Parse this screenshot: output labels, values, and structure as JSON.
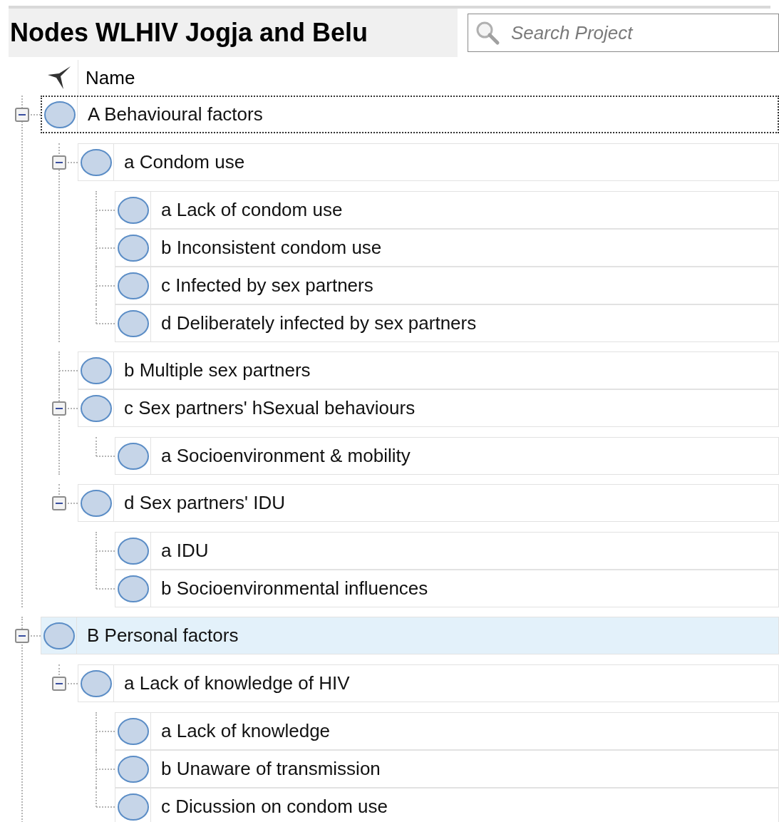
{
  "title": "Nodes WLHIV Jogja and Belu",
  "search": {
    "placeholder": "Search Project"
  },
  "columns": [
    "Name"
  ],
  "nodes": [
    {
      "name": "A Behavioural factors",
      "expanded": true,
      "selected": false,
      "focused": true,
      "children": [
        {
          "name": "a Condom use",
          "expanded": true,
          "selected": false,
          "focused": false,
          "children": [
            {
              "name": "a Lack of condom use",
              "selected": false,
              "focused": false
            },
            {
              "name": "b Inconsistent condom use",
              "selected": false,
              "focused": false
            },
            {
              "name": "c Infected by sex partners",
              "selected": false,
              "focused": false
            },
            {
              "name": "d Deliberately infected by sex partners",
              "selected": false,
              "focused": false
            }
          ]
        },
        {
          "name": "b Multiple sex partners",
          "selected": false,
          "focused": false
        },
        {
          "name": "c Sex partners' hSexual behaviours",
          "expanded": true,
          "selected": false,
          "focused": false,
          "children": [
            {
              "name": "a Socioenvironment & mobility",
              "selected": false,
              "focused": false
            }
          ]
        },
        {
          "name": "d Sex partners' IDU",
          "expanded": true,
          "selected": false,
          "focused": false,
          "children": [
            {
              "name": "a IDU",
              "selected": false,
              "focused": false
            },
            {
              "name": "b Socioenvironmental influences",
              "selected": false,
              "focused": false
            }
          ]
        }
      ]
    },
    {
      "name": "B Personal factors",
      "expanded": true,
      "selected": true,
      "focused": false,
      "children": [
        {
          "name": "a Lack of knowledge of HIV",
          "expanded": true,
          "selected": false,
          "focused": false,
          "children": [
            {
              "name": "a Lack of knowledge",
              "selected": false,
              "focused": false
            },
            {
              "name": "b Unaware of transmission",
              "selected": false,
              "focused": false
            },
            {
              "name": "c Dicussion on condom use",
              "selected": false,
              "focused": false
            }
          ]
        }
      ]
    }
  ]
}
